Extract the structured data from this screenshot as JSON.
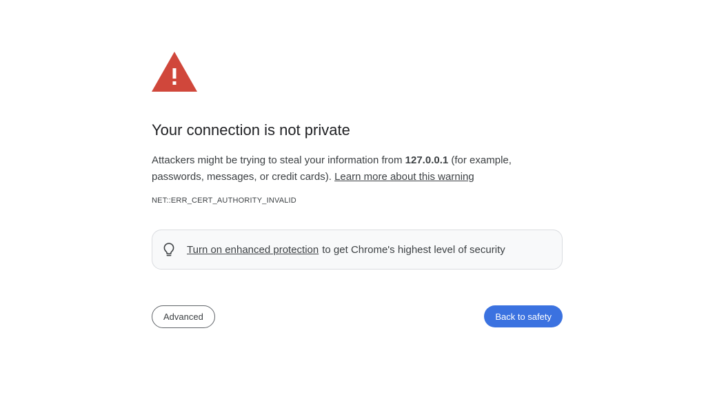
{
  "icons": {
    "warning": "warning-triangle-icon",
    "bulb": "lightbulb-icon"
  },
  "colors": {
    "warning_red": "#d0473b",
    "primary_button": "#3b72e0"
  },
  "interstitial": {
    "title": "Your connection is not private",
    "message_prefix": "Attackers might be trying to steal your information from ",
    "host": "127.0.0.1",
    "message_suffix": " (for example, passwords, messages, or credit cards). ",
    "learn_more_link": "Learn more about this warning",
    "error_code": "NET::ERR_CERT_AUTHORITY_INVALID"
  },
  "promo": {
    "link_text": "Turn on enhanced protection",
    "rest_text": "to get Chrome's highest level of security"
  },
  "buttons": {
    "advanced_label": "Advanced",
    "back_label": "Back to safety"
  }
}
